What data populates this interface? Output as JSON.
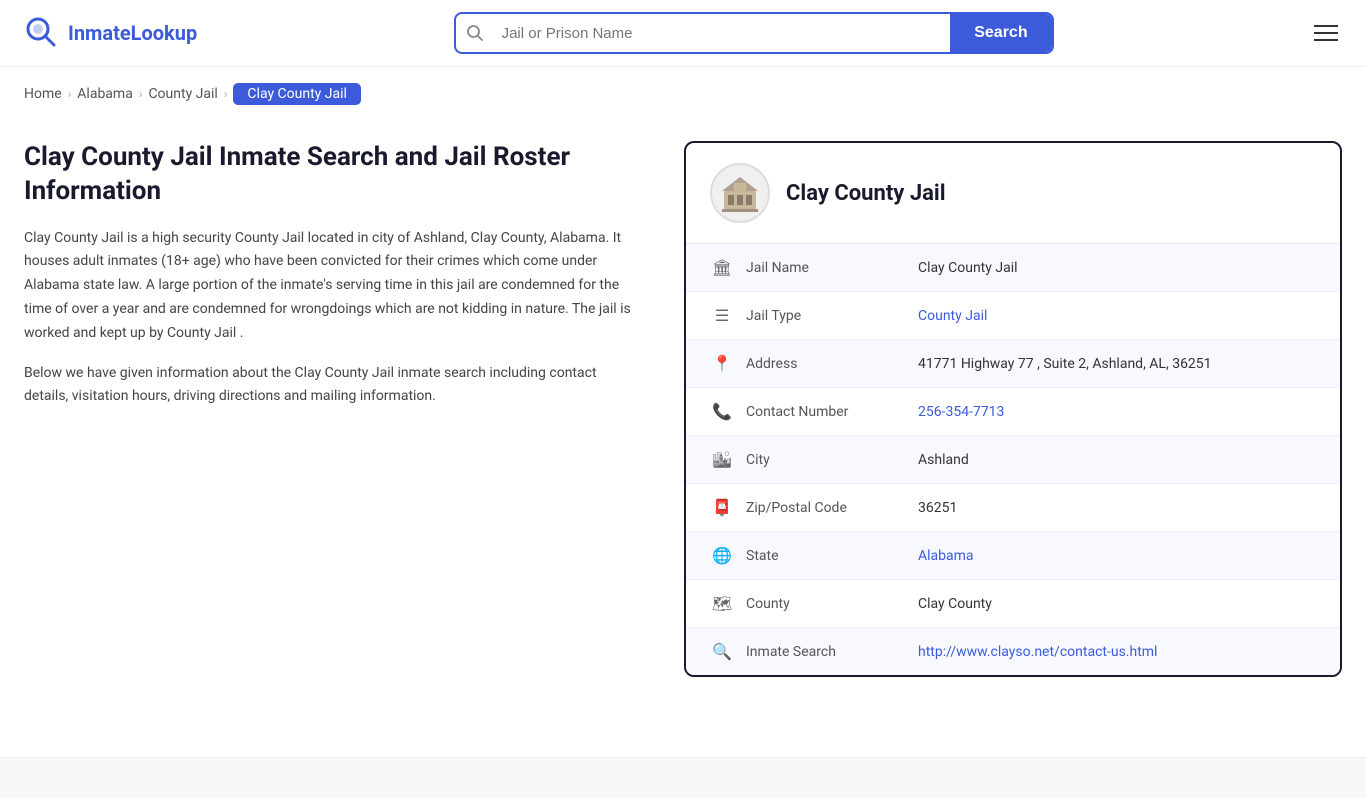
{
  "site": {
    "logo_text_part1": "Inmate",
    "logo_text_part2": "Lookup"
  },
  "header": {
    "search_placeholder": "Jail or Prison Name",
    "search_button_label": "Search"
  },
  "breadcrumb": {
    "items": [
      {
        "label": "Home",
        "href": "#"
      },
      {
        "label": "Alabama",
        "href": "#"
      },
      {
        "label": "County Jail",
        "href": "#"
      }
    ],
    "current": "Clay County Jail"
  },
  "page": {
    "title": "Clay County Jail Inmate Search and Jail Roster Information",
    "description1": "Clay County Jail is a high security County Jail located in city of Ashland, Clay County, Alabama. It houses adult inmates (18+ age) who have been convicted for their crimes which come under Alabama state law. A large portion of the inmate's serving time in this jail are condemned for the time of over a year and are condemned for wrongdoings which are not kidding in nature. The jail is worked and kept up by County Jail .",
    "description2": "Below we have given information about the Clay County Jail inmate search including contact details, visitation hours, driving directions and mailing information."
  },
  "info_card": {
    "jail_name_header": "Clay County Jail",
    "rows": [
      {
        "icon": "🏛",
        "label": "Jail Name",
        "value": "Clay County Jail",
        "link": null
      },
      {
        "icon": "☰",
        "label": "Jail Type",
        "value": "County Jail",
        "link": "#"
      },
      {
        "icon": "📍",
        "label": "Address",
        "value": "41771 Highway 77 , Suite 2, Ashland, AL, 36251",
        "link": null
      },
      {
        "icon": "📞",
        "label": "Contact Number",
        "value": "256-354-7713",
        "link": "tel:256-354-7713"
      },
      {
        "icon": "🏙",
        "label": "City",
        "value": "Ashland",
        "link": null
      },
      {
        "icon": "📮",
        "label": "Zip/Postal Code",
        "value": "36251",
        "link": null
      },
      {
        "icon": "🌐",
        "label": "State",
        "value": "Alabama",
        "link": "#"
      },
      {
        "icon": "🗺",
        "label": "County",
        "value": "Clay County",
        "link": null
      },
      {
        "icon": "🔍",
        "label": "Inmate Search",
        "value": "http://www.clayso.net/contact-us.html",
        "link": "http://www.clayso.net/contact-us.html"
      }
    ]
  }
}
